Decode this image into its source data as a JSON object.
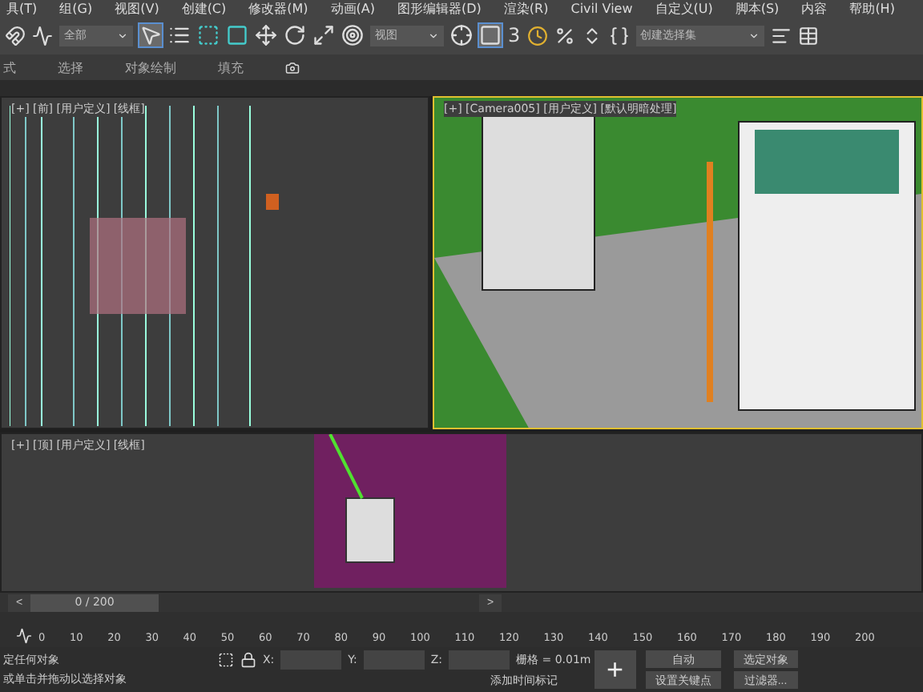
{
  "menu_bar": {
    "items": [
      "具(T)",
      "组(G)",
      "视图(V)",
      "创建(C)",
      "修改器(M)",
      "动画(A)",
      "图形编辑器(D)",
      "渲染(R)",
      "Civil View",
      "自定义(U)",
      "脚本(S)",
      "内容",
      "帮助(H)"
    ]
  },
  "toolbar": {
    "selection_filter": "全部",
    "reference_coord": "视图",
    "snap_label": "3",
    "selection_set": "创建选择集"
  },
  "ribbon": {
    "tabs": [
      {
        "label": "式",
        "selected": false
      },
      {
        "label": "选择",
        "selected": false
      },
      {
        "label": "对象绘制",
        "selected": false
      },
      {
        "label": "填充",
        "selected": false
      }
    ]
  },
  "viewports": [
    {
      "kind": "front",
      "label": "[+] [前] [用户定义] [线框]",
      "selected": false
    },
    {
      "kind": "camera",
      "label": "[+] [Camera005] [用户定义] [默认明暗处理]",
      "selected": true
    },
    {
      "kind": "top",
      "label": "[+] [顶] [用户定义] [线框]",
      "selected": false
    }
  ],
  "time_slider": {
    "prev": "<",
    "reading": "0 / 200",
    "next": ">",
    "level": 0
  },
  "track_bar": {
    "ticks": [
      "0",
      "10",
      "20",
      "30",
      "40",
      "50",
      "60",
      "70",
      "80",
      "90",
      "100",
      "110",
      "120",
      "130",
      "140",
      "150",
      "160",
      "170",
      "180",
      "190",
      "200"
    ]
  },
  "status_bar": {
    "selection_info": "定任何对象",
    "prompt": "或单击并拖动以选择对象",
    "x_label": "X:",
    "y_label": "Y:",
    "z_label": "Z:",
    "grid": "栅格 = 0.01m",
    "time_tag": "添加时间标记",
    "key_button": "+",
    "auto_key": "自动",
    "key_filter_select": "选定对象",
    "set_key": "设置关键点",
    "filters": "过滤器..."
  }
}
